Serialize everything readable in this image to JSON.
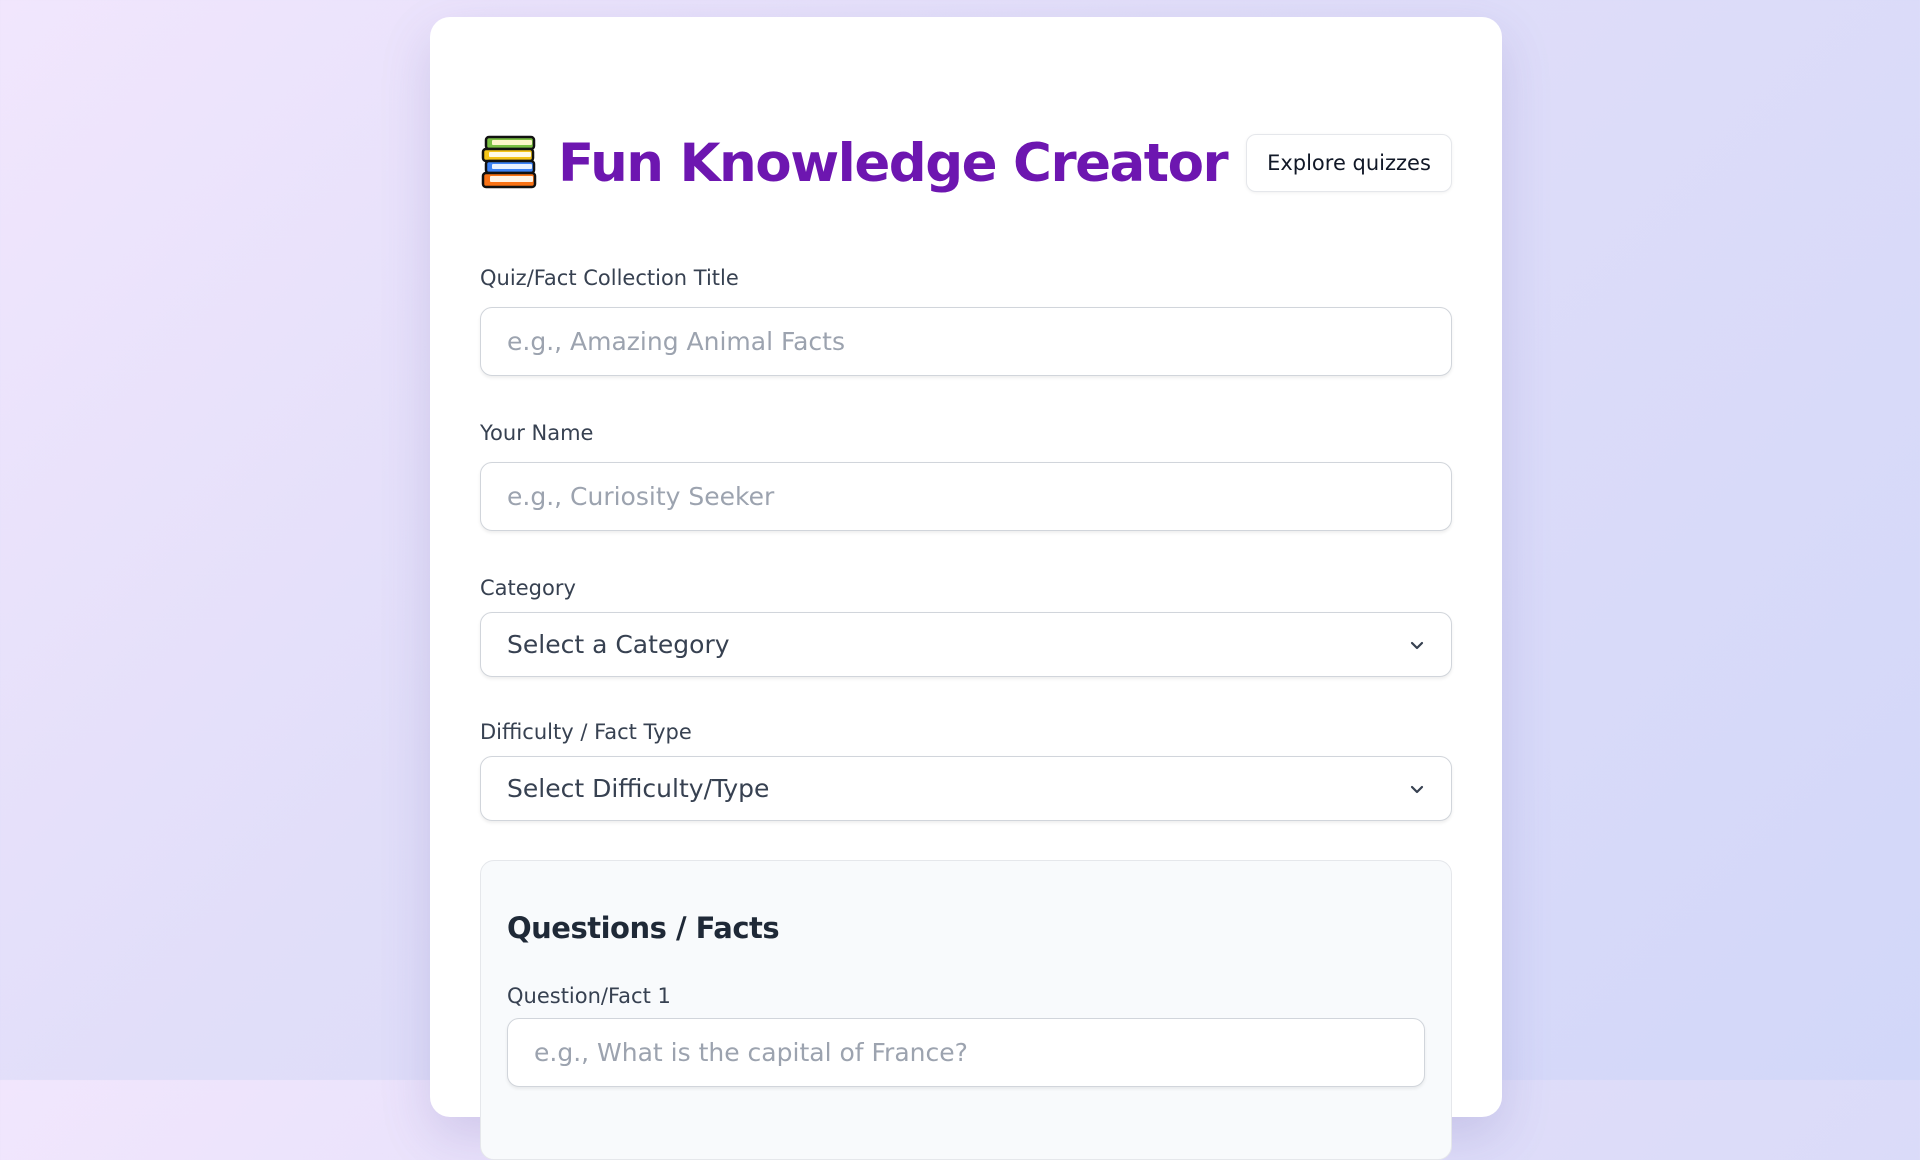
{
  "header": {
    "icon": "books-icon",
    "title": "Fun Knowledge Creator",
    "explore_label": "Explore quizzes"
  },
  "form": {
    "title_field": {
      "label": "Quiz/Fact Collection Title",
      "placeholder": "e.g., Amazing Animal Facts",
      "value": ""
    },
    "name_field": {
      "label": "Your Name",
      "placeholder": "e.g., Curiosity Seeker",
      "value": ""
    },
    "category": {
      "label": "Category",
      "selected": "Select a Category"
    },
    "difficulty": {
      "label": "Difficulty / Fact Type",
      "selected": "Select Difficulty/Type"
    }
  },
  "questions": {
    "heading": "Questions / Facts",
    "items": [
      {
        "label": "Question/Fact 1",
        "placeholder": "e.g., What is the capital of France?",
        "value": ""
      }
    ]
  },
  "colors": {
    "title": "#6d16b0",
    "background_start": "#f1e6fd",
    "background_end": "#d2d7f9"
  }
}
